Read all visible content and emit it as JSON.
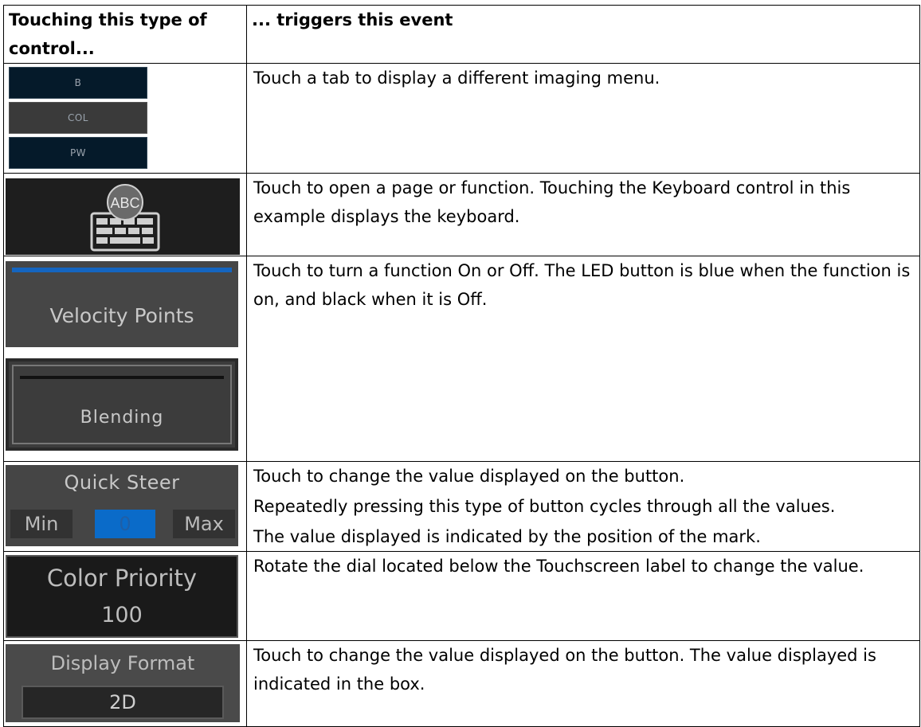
{
  "header": {
    "col1": "Touching this type of control...",
    "col2": "... triggers this event"
  },
  "rows": [
    {
      "tabs": [
        "B",
        "COL",
        "PW"
      ],
      "desc": [
        "Touch a tab to display a different imaging menu."
      ]
    },
    {
      "keyboard_label": "ABC",
      "desc": [
        "Touch to open a page or function. Touching the Keyboard control in this example displays the keyboard."
      ]
    },
    {
      "led_on_label": "Velocity Points",
      "led_off_label": "Blending",
      "led_on_color": "#1565c0",
      "led_off_color": "#111111",
      "desc": [
        "Touch to turn a function On or Off. The LED button is blue when the function is on, and black when it is Off."
      ]
    },
    {
      "title": "Quick Steer",
      "min": "Min",
      "value": "0",
      "max": "Max",
      "desc": [
        "Touch to change the value displayed on the button.",
        "Repeatedly pressing this type of button cycles through all the values.",
        "The value displayed is indicated by the position of the mark."
      ]
    },
    {
      "title": "Color Priority",
      "value": "100",
      "desc": [
        "Rotate the dial located below the Touchscreen label to change the value."
      ]
    },
    {
      "title": "Display Format",
      "value": "2D",
      "desc": [
        "Touch to change the value displayed on the button. The value displayed is indicated in the box."
      ]
    }
  ]
}
